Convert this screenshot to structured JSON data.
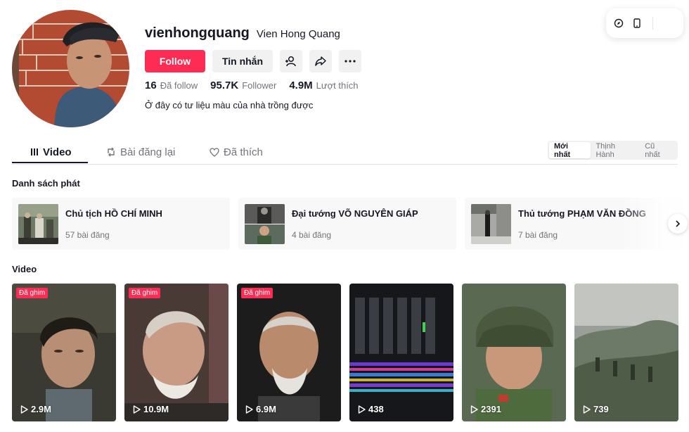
{
  "profile": {
    "username": "vienhongquang",
    "nickname": "Vien Hong Quang",
    "follow_label": "Follow",
    "message_label": "Tin nhắn",
    "bio": "Ở đây có tư liệu màu của nhà trồng được",
    "stats": [
      {
        "value": "16",
        "label": "Đã follow"
      },
      {
        "value": "95.7K",
        "label": "Follower"
      },
      {
        "value": "4.9M",
        "label": "Lượt thích"
      }
    ]
  },
  "tabs": [
    {
      "label": "Video",
      "icon": "grid-icon"
    },
    {
      "label": "Bài đăng lại",
      "icon": "repost-icon"
    },
    {
      "label": "Đã thích",
      "icon": "heart-icon"
    }
  ],
  "sort_options": [
    "Mới nhất",
    "Thịnh Hành",
    "Cũ nhất"
  ],
  "playlists_title": "Danh sách phát",
  "playlists": [
    {
      "title": "Chủ tịch HỒ CHÍ MINH",
      "count": "57 bài đăng"
    },
    {
      "title": "Đại tướng VÕ NGUYÊN GIÁP",
      "count": "4 bài đăng"
    },
    {
      "title": "Thủ tướng PHẠM VĂN ĐỒNG",
      "count": "7 bài đăng"
    }
  ],
  "videos_title": "Video",
  "pinned_label": "Đã ghim",
  "videos": [
    {
      "views": "2.9M",
      "pinned": true
    },
    {
      "views": "10.9M",
      "pinned": true
    },
    {
      "views": "6.9M",
      "pinned": true
    },
    {
      "views": "438",
      "pinned": false
    },
    {
      "views": "2391",
      "pinned": false
    },
    {
      "views": "739",
      "pinned": false
    }
  ],
  "colors": {
    "accent": "#fe2c55",
    "text": "#161823",
    "muted": "#73747b"
  }
}
